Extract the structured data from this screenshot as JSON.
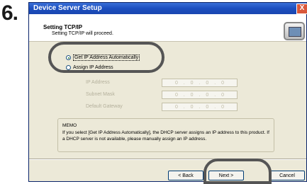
{
  "step_number": "6.",
  "window": {
    "title": "Device Server Setup",
    "close_glyph": "X"
  },
  "header": {
    "title": "Setting TCP/IP",
    "subtitle": "Setting TCP/IP will proceed."
  },
  "options": {
    "auto": {
      "label": "Get IP Address Automatically",
      "checked": true
    },
    "manual": {
      "label": "Assign IP Address",
      "checked": false
    }
  },
  "fields": [
    {
      "label": "IP Address",
      "value": [
        "0",
        "0",
        "0",
        "0"
      ]
    },
    {
      "label": "Subnet Mask",
      "value": [
        "0",
        "0",
        "0",
        "0"
      ]
    },
    {
      "label": "Default Gateway",
      "value": [
        "0",
        "0",
        "0",
        "0"
      ]
    }
  ],
  "memo": {
    "title": "MEMO",
    "text": "If you select [Get IP Address Automatically], the DHCP server assigns an IP address to this product. If a DHCP server is not available, please manually assign an IP address."
  },
  "buttons": {
    "back": "< Back",
    "next": "Next >",
    "cancel": "Cancel"
  }
}
